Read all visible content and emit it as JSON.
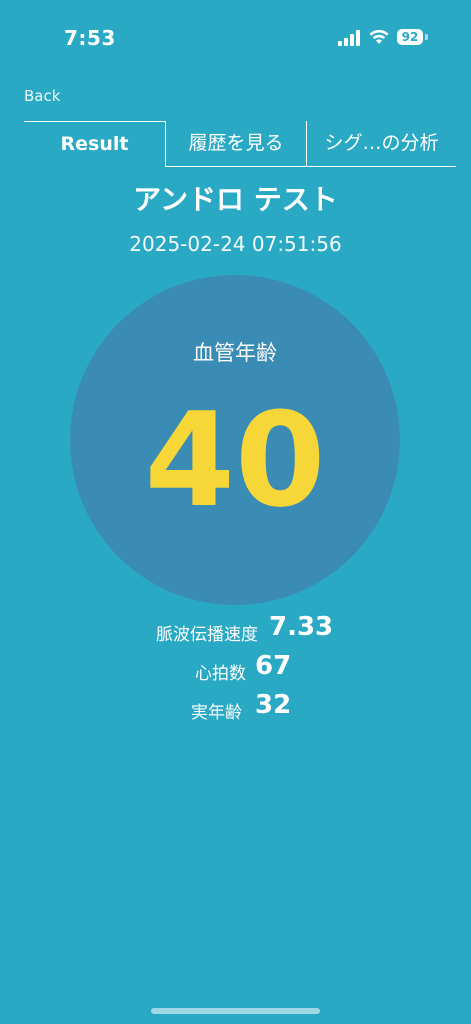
{
  "status_bar": {
    "time": "7:53",
    "battery": "92"
  },
  "nav": {
    "back_label": "Back"
  },
  "tabs": [
    {
      "label": "Result"
    },
    {
      "label": "履歴を見る"
    },
    {
      "label": "シグ…の分析"
    }
  ],
  "header": {
    "title": "アンドロ テスト",
    "timestamp": "2025-02-24 07:51:56"
  },
  "result": {
    "label": "血管年齢",
    "value": "40"
  },
  "metrics": [
    {
      "label": "脈波伝播速度",
      "value": "7.33"
    },
    {
      "label": "心拍数",
      "value": "67"
    },
    {
      "label": "実年齢",
      "value": "32"
    }
  ],
  "colors": {
    "background": "#2aa9c5",
    "circle": "#3a8cb4",
    "accent_value": "#f7d637"
  }
}
